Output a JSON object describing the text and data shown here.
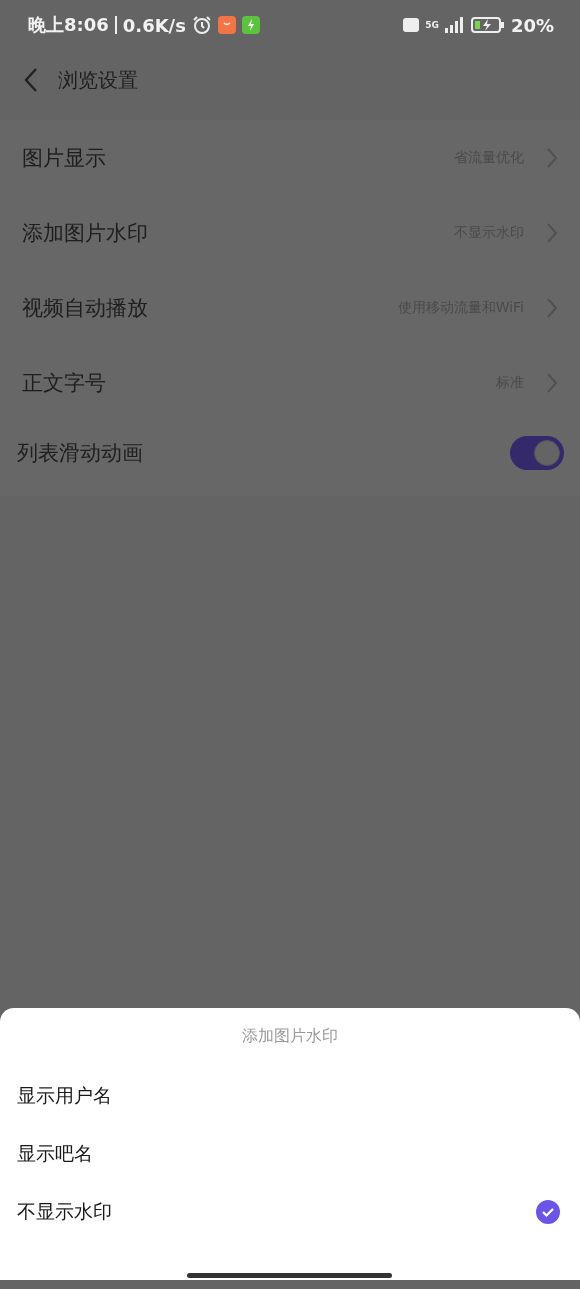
{
  "status_bar": {
    "time": "晚上8:06",
    "speed": "0.6K/s",
    "signal": "5G",
    "battery": "20%"
  },
  "header": {
    "title": "浏览设置"
  },
  "settings": [
    {
      "kind": "link",
      "label": "图片显示",
      "value": "省流量优化"
    },
    {
      "kind": "link",
      "label": "添加图片水印",
      "value": "不显示水印"
    },
    {
      "kind": "link",
      "label": "视频自动播放",
      "value": "使用移动流量和WiFi"
    },
    {
      "kind": "link",
      "label": "正文字号",
      "value": "标准"
    },
    {
      "kind": "toggle",
      "label": "列表滑动动画",
      "on": true
    }
  ],
  "sheet": {
    "title": "添加图片水印",
    "options": [
      {
        "label": "显示用户名",
        "selected": false
      },
      {
        "label": "显示吧名",
        "selected": false
      },
      {
        "label": "不显示水印",
        "selected": true
      }
    ]
  }
}
